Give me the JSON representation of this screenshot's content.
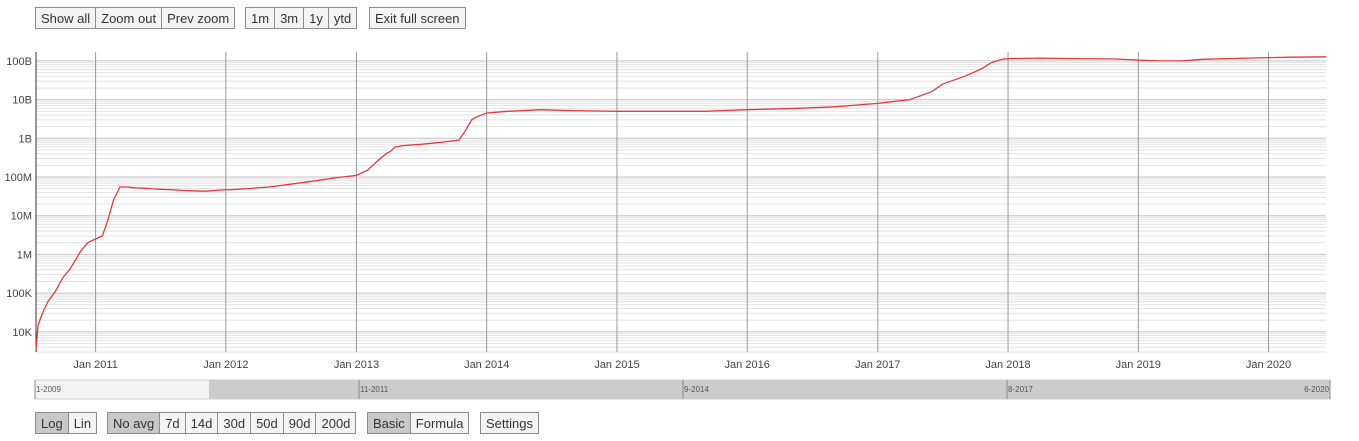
{
  "toolbar_top": {
    "zoom": [
      "Show all",
      "Zoom out",
      "Prev zoom"
    ],
    "ranges": [
      "1m",
      "3m",
      "1y",
      "ytd"
    ],
    "fullscreen": "Exit full screen"
  },
  "toolbar_bottom": {
    "scale": [
      "Log",
      "Lin"
    ],
    "avg": [
      "No avg",
      "7d",
      "14d",
      "30d",
      "50d",
      "90d",
      "200d"
    ],
    "mode": [
      "Basic",
      "Formula"
    ],
    "settings": "Settings"
  },
  "navigator": {
    "labels": [
      "1-2009",
      "11-2011",
      "9-2014",
      "8-2017",
      "6-2020"
    ]
  },
  "chart_data": {
    "type": "line",
    "title": "",
    "xlabel": "",
    "ylabel": "",
    "y_scale": "log",
    "ylim": [
      3000,
      170000000000
    ],
    "xlim": [
      "2010-07-18",
      "2020-06-10"
    ],
    "line_color": "#e8383d",
    "grid": true,
    "y_ticks": [
      {
        "value": 10000,
        "label": "10K"
      },
      {
        "value": 100000,
        "label": "100K"
      },
      {
        "value": 1000000,
        "label": "1M"
      },
      {
        "value": 10000000,
        "label": "10M"
      },
      {
        "value": 100000000,
        "label": "100M"
      },
      {
        "value": 1000000000,
        "label": "1B"
      },
      {
        "value": 10000000000,
        "label": "10B"
      },
      {
        "value": 100000000000,
        "label": "100B"
      }
    ],
    "x_ticks": [
      {
        "value": "2011-01-01",
        "label": "Jan 2011"
      },
      {
        "value": "2012-01-01",
        "label": "Jan 2012"
      },
      {
        "value": "2013-01-01",
        "label": "Jan 2013"
      },
      {
        "value": "2014-01-01",
        "label": "Jan 2014"
      },
      {
        "value": "2015-01-01",
        "label": "Jan 2015"
      },
      {
        "value": "2016-01-01",
        "label": "Jan 2016"
      },
      {
        "value": "2017-01-01",
        "label": "Jan 2017"
      },
      {
        "value": "2018-01-01",
        "label": "Jan 2018"
      },
      {
        "value": "2019-01-01",
        "label": "Jan 2019"
      },
      {
        "value": "2020-01-01",
        "label": "Jan 2020"
      }
    ],
    "series": [
      {
        "x": [
          "2010-07-18",
          "2010-07-24",
          "2010-08-05",
          "2010-08-20",
          "2010-09-10",
          "2010-10-01",
          "2010-10-20",
          "2010-11-05",
          "2010-11-20",
          "2010-12-10",
          "2011-01-01",
          "2011-01-20",
          "2011-02-05",
          "2011-02-20",
          "2011-03-10",
          "2011-04-01",
          "2011-04-15",
          "2011-04-25",
          "2011-05-05",
          "2011-05-15",
          "2011-05-25",
          "2011-06-05",
          "2011-06-15",
          "2011-07-01",
          "2011-08-01",
          "2011-09-01",
          "2011-10-01",
          "2011-11-01",
          "2011-11-20",
          "2011-12-15",
          "2012-01-15",
          "2012-03-01",
          "2012-05-01",
          "2012-07-01",
          "2012-09-01",
          "2012-11-01",
          "2013-01-01",
          "2013-02-01",
          "2013-03-01",
          "2013-03-25",
          "2013-04-05",
          "2013-04-20",
          "2013-05-15",
          "2013-07-01",
          "2013-09-01",
          "2013-10-15",
          "2013-11-01",
          "2013-11-20",
          "2013-12-01",
          "2014-01-01",
          "2014-03-01",
          "2014-06-01",
          "2014-09-01",
          "2015-01-01",
          "2015-06-01",
          "2015-09-01",
          "2016-01-01",
          "2016-06-01",
          "2016-09-01",
          "2017-01-01",
          "2017-04-01",
          "2017-06-01",
          "2017-07-01",
          "2017-09-01",
          "2017-10-15",
          "2017-11-15",
          "2017-12-15",
          "2018-01-01",
          "2018-04-01",
          "2018-07-01",
          "2018-11-01",
          "2019-01-01",
          "2019-03-01",
          "2019-05-01",
          "2019-07-01",
          "2019-12-01",
          "2020-03-01",
          "2020-06-10"
        ],
        "y": [
          3500,
          15000,
          30000,
          60000,
          110000,
          250000,
          400000,
          700000,
          1200000,
          2000000,
          2500000,
          3000000,
          8000000,
          25000000,
          55000000,
          55000000,
          53000000,
          52000000,
          52000000,
          51000000,
          51000000,
          50000000,
          49000000,
          48000000,
          47000000,
          45000000,
          44000000,
          43000000,
          44000000,
          46000000,
          47000000,
          50000000,
          55000000,
          65000000,
          78000000,
          95000000,
          110000000,
          150000000,
          260000000,
          400000000,
          450000000,
          600000000,
          650000000,
          700000000,
          800000000,
          900000000,
          1500000000,
          3000000000,
          3500000000,
          4500000000,
          5000000000,
          5500000000,
          5200000000,
          5000000000,
          5000000000,
          5000000000,
          5500000000,
          6000000000,
          6500000000,
          8000000000,
          10000000000,
          16000000000,
          25000000000,
          40000000000,
          60000000000,
          90000000000,
          110000000000,
          115000000000,
          118000000000,
          115000000000,
          112000000000,
          105000000000,
          100000000000,
          100000000000,
          110000000000,
          120000000000,
          125000000000,
          128000000000
        ]
      }
    ]
  }
}
